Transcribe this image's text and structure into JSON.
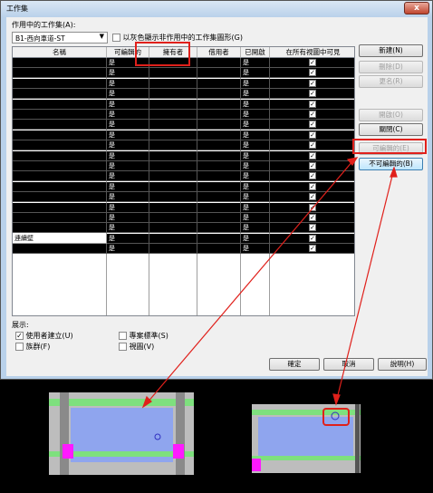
{
  "dialog": {
    "title": "工作集",
    "close_glyph": "x",
    "active_label": "作用中的工作集(A):",
    "active_value": "B1-西向車道-ST",
    "gray_toggle_label": "以灰色顯示非作用中的工作集圖形(G)",
    "columns": [
      "名稱",
      "可編輯的",
      "擁有者",
      "借用者",
      "已開啟",
      "在所有視圖中可見"
    ],
    "rows_count_label": "",
    "rows": [
      {
        "name": "",
        "editable": "是",
        "opened": "是",
        "visible": true
      },
      {
        "name": "",
        "editable": "是",
        "opened": "是",
        "visible": true
      },
      {
        "name": "",
        "editable": "是",
        "opened": "是",
        "visible": true
      },
      {
        "name": "",
        "editable": "是",
        "opened": "是",
        "visible": true
      },
      {
        "name": "",
        "editable": "是",
        "opened": "是",
        "visible": true
      },
      {
        "name": "",
        "editable": "是",
        "opened": "是",
        "visible": true
      },
      {
        "name": "",
        "editable": "是",
        "opened": "是",
        "visible": true
      },
      {
        "name": "",
        "editable": "是",
        "opened": "是",
        "visible": true
      },
      {
        "name": "",
        "editable": "是",
        "opened": "是",
        "visible": true
      },
      {
        "name": "",
        "editable": "是",
        "opened": "是",
        "visible": true
      },
      {
        "name": "",
        "editable": "是",
        "opened": "是",
        "visible": true
      },
      {
        "name": "",
        "editable": "是",
        "opened": "是",
        "visible": true
      },
      {
        "name": "",
        "editable": "是",
        "opened": "是",
        "visible": true
      },
      {
        "name": "",
        "editable": "是",
        "opened": "是",
        "visible": true
      },
      {
        "name": "",
        "editable": "是",
        "opened": "是",
        "visible": true
      },
      {
        "name": "",
        "editable": "是",
        "opened": "是",
        "visible": true
      },
      {
        "name": "",
        "editable": "是",
        "opened": "是",
        "visible": true
      },
      {
        "name": "連續壁",
        "editable": "是",
        "opened": "是",
        "visible": true
      },
      {
        "name": "",
        "editable": "是",
        "opened": "是",
        "visible": true
      }
    ],
    "buttons": {
      "new": "新建(N)",
      "delete": "刪除(D)",
      "rename": "更名(R)",
      "open": "開啟(O)",
      "close": "關閉(C)",
      "editable": "可編輯的(E)",
      "non_editable": "不可編輯的(B)",
      "ok": "確定",
      "cancel": "取消",
      "help": "說明(H)"
    },
    "show": {
      "label": "展示:",
      "user_created": "使用者建立(U)",
      "project_standards": "專案標準(S)",
      "families": "族群(F)",
      "views": "視圖(V)"
    }
  },
  "colors": {
    "highlight_red": "#e0201b",
    "fill_blue": "#8fa5ee",
    "wall_green": "#7ee07e",
    "marker_magenta": "#ff19ff"
  }
}
